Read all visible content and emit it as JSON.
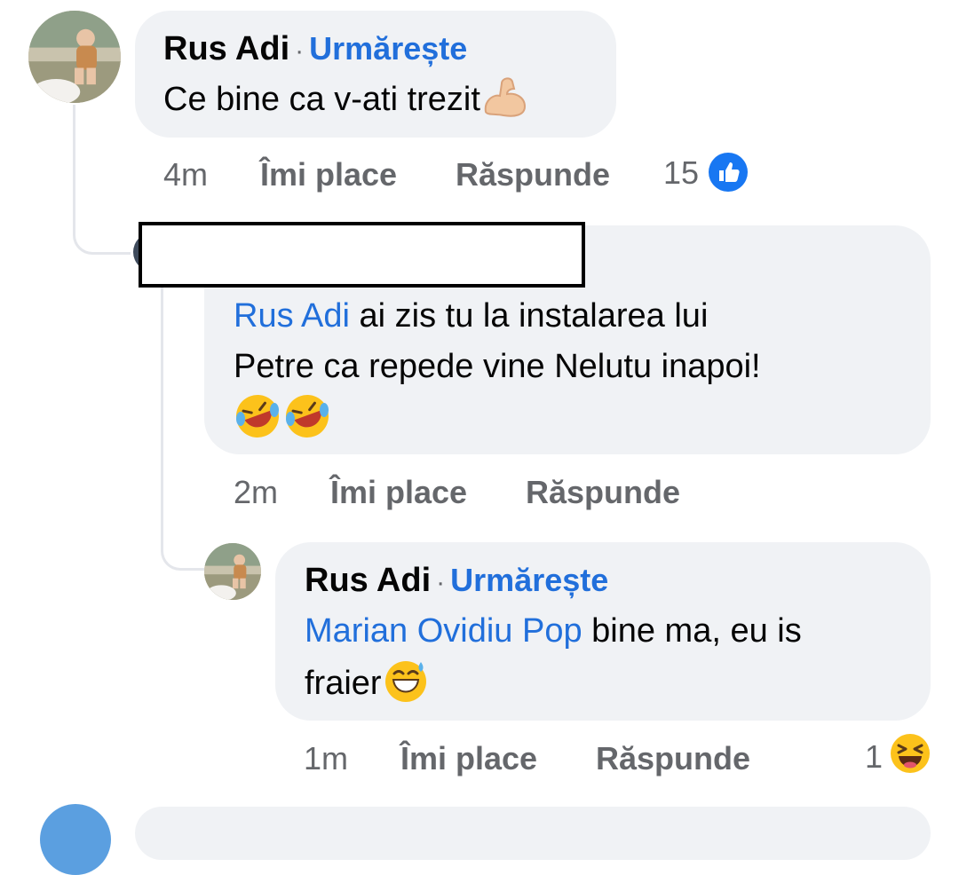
{
  "comments": [
    {
      "author": "Rus Adi",
      "separator": "·",
      "follow": "Urmărește",
      "text": "Ce bine ca v-ati trezit",
      "emoji": "flexed-biceps",
      "time": "4m",
      "like": "Îmi place",
      "reply": "Răspunde",
      "reaction_count": "15",
      "reaction": "like"
    },
    {
      "author_redacted": true,
      "mention": "Rus Adi",
      "text_line1": " ai zis tu la instalarea lui",
      "text_line2": "Petre ca repede vine Nelutu inapoi!",
      "emoji": "rolling-on-floor-laughing x2",
      "time": "2m",
      "like": "Îmi place",
      "reply": "Răspunde"
    },
    {
      "author": "Rus Adi",
      "separator": "·",
      "follow": "Urmărește",
      "mention": "Marian Ovidiu Pop",
      "text_line1": " bine ma, eu is",
      "text_line2": "fraier",
      "emoji": "grinning-sweat",
      "time": "1m",
      "like": "Îmi place",
      "reply": "Răspunde",
      "reaction_count": "1",
      "reaction": "haha"
    }
  ],
  "colors": {
    "bubble": "#f0f2f5",
    "link": "#216fdb",
    "meta": "#65676b",
    "thread_line": "#e4e6eb"
  }
}
